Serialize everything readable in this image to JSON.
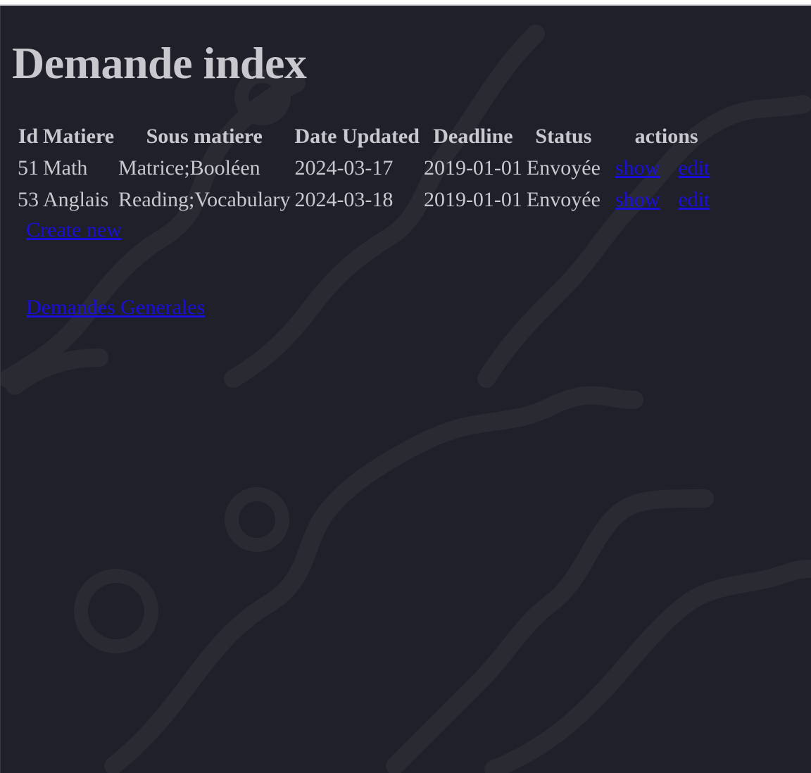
{
  "page": {
    "title": "Demande index"
  },
  "table": {
    "headers": {
      "id": "Id",
      "matiere": "Matiere",
      "sous_matiere": "Sous matiere",
      "date_updated": "Date Updated",
      "deadline": "Deadline",
      "status": "Status",
      "actions": "actions"
    },
    "rows": [
      {
        "id": "51",
        "matiere": "Math",
        "sous_matiere": "Matrice;Booléen",
        "date_updated": "2024-03-17",
        "deadline": "2019-01-01",
        "status": "Envoyée",
        "show_label": "show",
        "edit_label": "edit"
      },
      {
        "id": "53",
        "matiere": "Anglais",
        "sous_matiere": "Reading;Vocabulary",
        "date_updated": "2024-03-18",
        "deadline": "2019-01-01",
        "status": "Envoyée",
        "show_label": "show",
        "edit_label": "edit"
      }
    ]
  },
  "links": {
    "create_new": "Create new",
    "demandes_generales": "Demandes Generales"
  },
  "colors": {
    "background": "#1f2029",
    "text": "#c8c8ce",
    "link": "#1a0fd9",
    "decor": "#2a2a33"
  }
}
